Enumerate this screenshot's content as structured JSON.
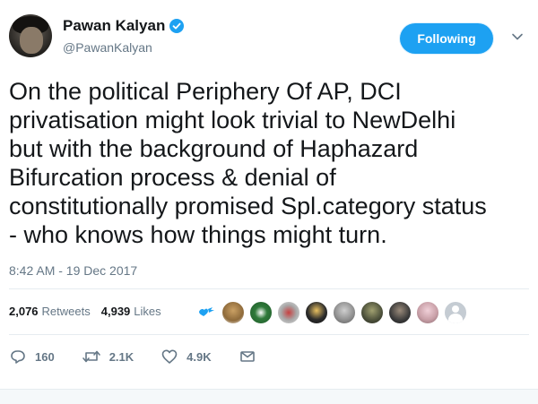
{
  "author": {
    "display_name": "Pawan Kalyan",
    "handle": "@PawanKalyan",
    "verified": true
  },
  "follow_button": {
    "label": "Following"
  },
  "tweet": {
    "text": "On the political Periphery Of AP, DCI\nprivatisation might look trivial to NewDelhi\nbut with the background of Haphazard\nBifurcation process & denial of\nconstitutionally promised Spl.category status\n- who knows how things might turn.",
    "timestamp": "8:42 AM - 19 Dec 2017"
  },
  "stats": {
    "retweets_count": "2,076",
    "retweets_label": "Retweets",
    "likes_count": "4,939",
    "likes_label": "Likes"
  },
  "likers": [
    {
      "icon": "twitter-heart-icon",
      "color": "#1da1f2"
    },
    {
      "icon": "avatar",
      "color": "#8e6a3a"
    },
    {
      "icon": "avatar",
      "color": "#2f7a3a"
    },
    {
      "icon": "avatar",
      "color": "#a8a8a8"
    },
    {
      "icon": "avatar",
      "color": "#2b2b2b"
    },
    {
      "icon": "avatar",
      "color": "#8c8c8c"
    },
    {
      "icon": "avatar",
      "color": "#4b4f3a"
    },
    {
      "icon": "avatar",
      "color": "#3a3a3a"
    },
    {
      "icon": "avatar",
      "color": "#c9a0a8"
    },
    {
      "icon": "default-avatar",
      "color": "#c5ccd3"
    }
  ],
  "actions": {
    "reply_count": "160",
    "retweet_count": "2.1K",
    "like_count": "4.9K"
  },
  "colors": {
    "accent": "#1da1f2",
    "text": "#14171a",
    "secondary": "#657786",
    "border": "#e6ecf0"
  }
}
